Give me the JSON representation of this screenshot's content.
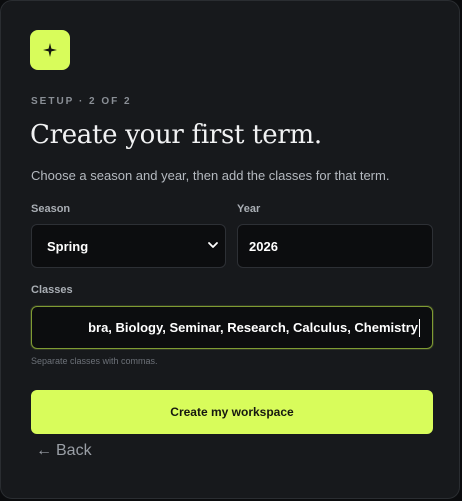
{
  "header": {
    "step": "SETUP · 2 OF 2",
    "title": "Create your first term.",
    "subtitle": "Choose a season and year, then add the classes for that term."
  },
  "form": {
    "season": {
      "label": "Season",
      "value": "Spring"
    },
    "year": {
      "label": "Year",
      "value": "2026"
    },
    "classes": {
      "label": "Classes",
      "value": "bra, Biology, Seminar, Research, Calculus, Chemistry",
      "hint": "Separate classes with commas."
    }
  },
  "actions": {
    "submit_label": "Create my workspace",
    "back_arrow": "←",
    "back_label": "Back"
  },
  "colors": {
    "accent": "#d8fc5b",
    "card_background": "#17191c",
    "input_background": "#0c0d0f"
  },
  "icons": {
    "logo": "sparkle-icon",
    "season_dropdown": "chevron-down-icon"
  }
}
